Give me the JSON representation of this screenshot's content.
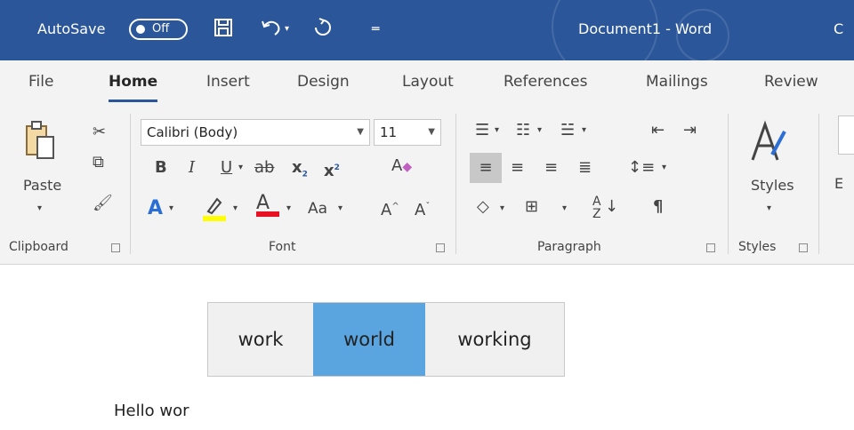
{
  "titlebar": {
    "autosave_label": "AutoSave",
    "autosave_state": "Off",
    "document_title": "Document1  -  Word",
    "overflow_text": "C"
  },
  "tabs": [
    {
      "label": "File"
    },
    {
      "label": "Home",
      "active": true
    },
    {
      "label": "Insert"
    },
    {
      "label": "Design"
    },
    {
      "label": "Layout"
    },
    {
      "label": "References"
    },
    {
      "label": "Mailings"
    },
    {
      "label": "Review"
    }
  ],
  "clipboard": {
    "paste_label": "Paste",
    "group_label": "Clipboard"
  },
  "font": {
    "font_name": "Calibri (Body)",
    "font_size": "11",
    "bold": "B",
    "italic": "I",
    "underline": "U",
    "strike": "ab",
    "subscript": "x",
    "superscript": "x",
    "change_case": "Aa",
    "text_effect": "A",
    "font_color": "A",
    "grow": "A",
    "shrink": "A",
    "group_label": "Font"
  },
  "paragraph": {
    "group_label": "Paragraph",
    "pilcrow": "¶"
  },
  "styles": {
    "label": "Styles",
    "group_label": "Styles"
  },
  "editing": {
    "partial_label": "E"
  },
  "suggestions": {
    "items": [
      "work",
      "world",
      "working"
    ],
    "selected_index": 1
  },
  "document": {
    "text": "Hello wor"
  },
  "colors": {
    "titlebar": "#2b579a",
    "accent": "#2b579a",
    "selection": "#5aa5e0",
    "highlight": "#ffff00",
    "font_color": "#e81123"
  }
}
